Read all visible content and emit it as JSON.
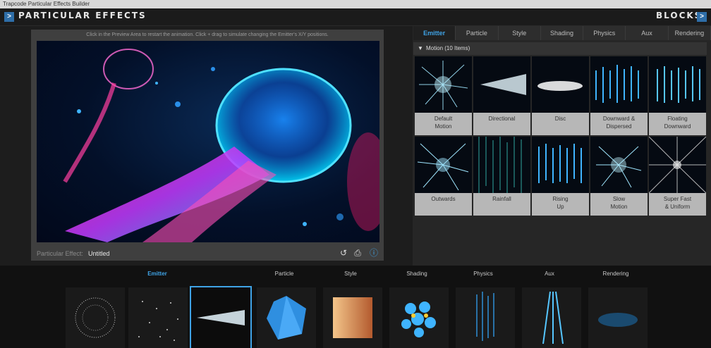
{
  "window": {
    "title": "Trapcode Particular Effects Builder"
  },
  "header": {
    "left_title": "PARTICULAR EFFECTS",
    "right_title": "BLOCKS",
    "chevron": ">"
  },
  "preview": {
    "hint": "Click in the Preview Area to restart the animation. Click + drag to simulate changing the Emitter's X/Y positions.",
    "effect_label": "Particular Effect:",
    "effect_name": "Untitled",
    "controls": [
      "undo-icon",
      "save-icon",
      "help-icon"
    ]
  },
  "right": {
    "tabs": [
      "Emitter",
      "Particle",
      "Style",
      "Shading",
      "Physics",
      "Aux",
      "Rendering"
    ],
    "active_tab": "Emitter",
    "section_title": "Motion  (10 Items)",
    "items": [
      "Default\nMotion",
      "Directional",
      "Disc",
      "Downward &\nDispersed",
      "Floating\nDownward",
      "Outwards",
      "Rainfall",
      "Rising\nUp",
      "Slow\nMotion",
      "Super Fast\n& Uniform"
    ]
  },
  "bottom": {
    "labels": [
      "Emitter",
      "Particle",
      "Style",
      "Shading",
      "Physics",
      "Aux",
      "Rendering"
    ],
    "active": "Emitter"
  },
  "colors": {
    "accent": "#3fa3e6",
    "brand_blue": "#2e6ea8"
  }
}
